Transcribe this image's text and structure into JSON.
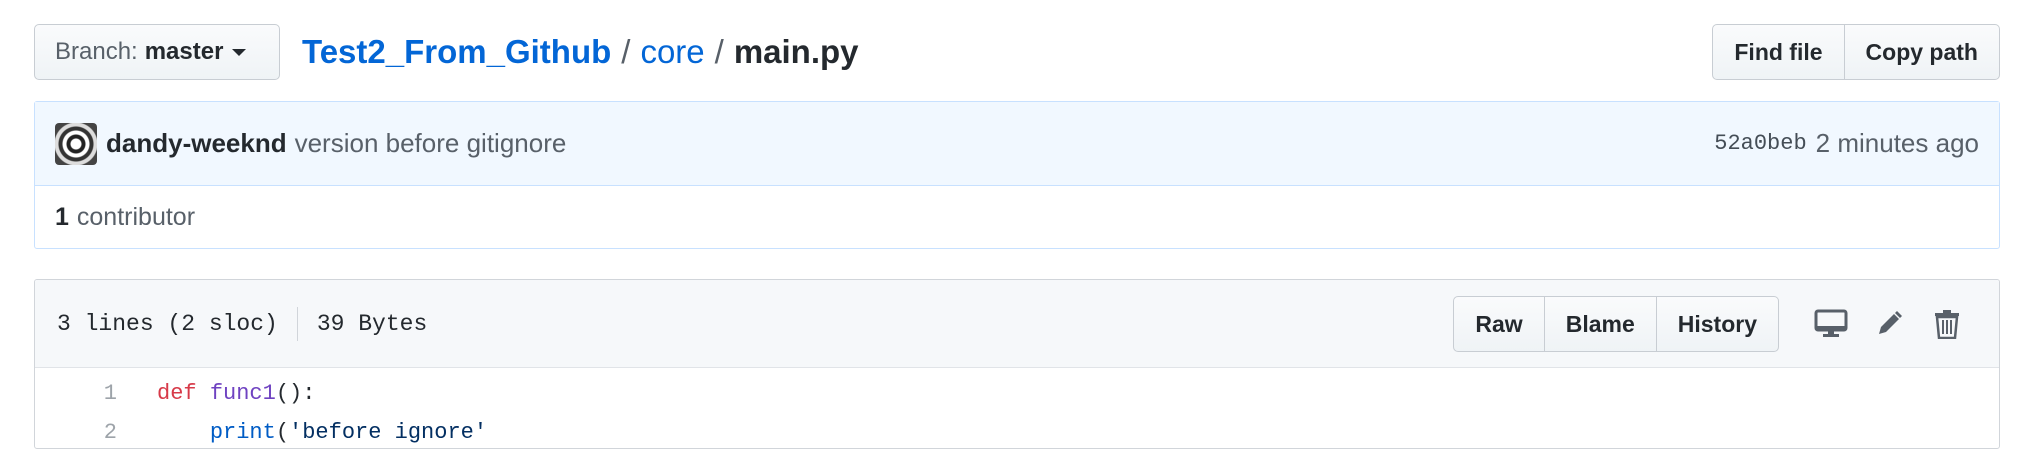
{
  "branch": {
    "label": "Branch:",
    "name": "master"
  },
  "breadcrumb": {
    "repo": "Test2_From_Github",
    "sep1": "/",
    "folder": "core",
    "sep2": "/",
    "file": "main.py"
  },
  "top_actions": {
    "find_file": "Find file",
    "copy_path": "Copy path"
  },
  "commit": {
    "author": "dandy-weeknd",
    "message": "version before gitignore",
    "sha": "52a0beb",
    "time": "2 minutes ago"
  },
  "contributors": {
    "count": "1",
    "label": "contributor"
  },
  "file_info": {
    "lines": "3 lines (2 sloc)",
    "size": "39 Bytes"
  },
  "file_actions": {
    "raw": "Raw",
    "blame": "Blame",
    "history": "History"
  },
  "icons": [
    "desktop-icon",
    "pencil-icon",
    "trash-icon"
  ],
  "code": {
    "lines": [
      {
        "num": "1",
        "keyword": "def",
        "name": "func1",
        "rest": "():"
      },
      {
        "num": "2",
        "indent": "    ",
        "builtin": "print",
        "open": "(",
        "string": "'before ignore'"
      }
    ]
  },
  "colors": {
    "link": "#0366d6",
    "commit_bg": "#f1f8ff",
    "keyword": "#d73a49",
    "function": "#6f42c1",
    "builtin": "#005cc5",
    "string": "#032f62"
  }
}
